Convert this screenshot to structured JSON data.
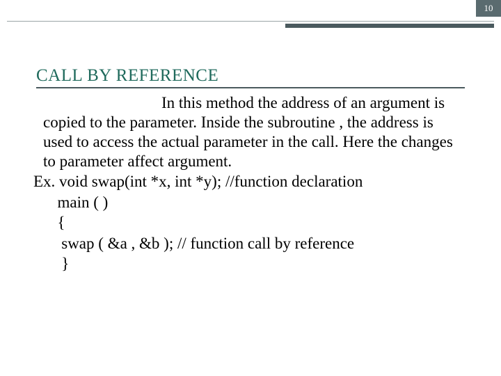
{
  "page_number": "10",
  "title": "CALL BY REFERENCE",
  "paragraph": "In this method the address of an argument is copied to the parameter. Inside the subroutine , the address is used to access the actual parameter in the call. Here the changes to parameter affect argument.",
  "code_lines": {
    "l0": "Ex. void swap(int *x, int *y); //function declaration",
    "l1": "      main ( )",
    "l2": "      {",
    "l3": "       swap ( &a , &b ); // function call by reference",
    "l4": "       }"
  }
}
